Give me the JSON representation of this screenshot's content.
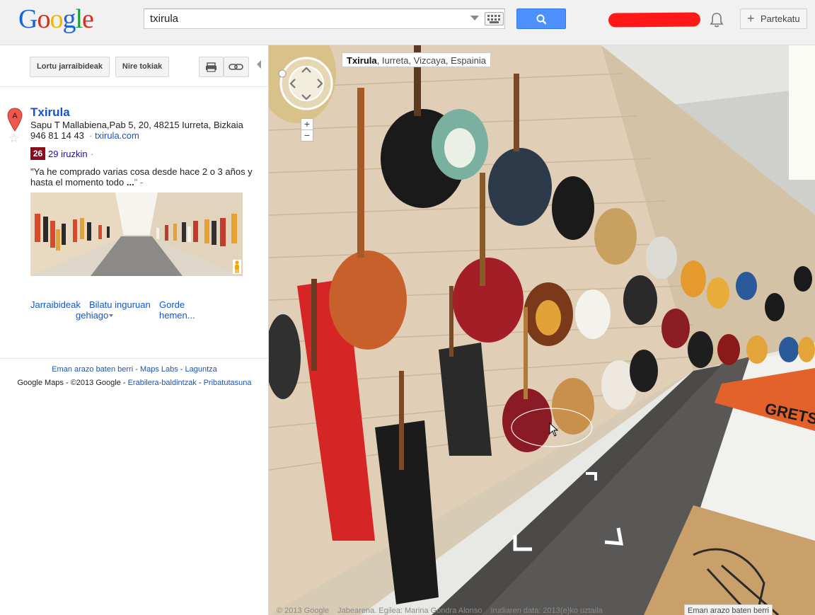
{
  "header": {
    "logo_text": "Google",
    "search_value": "txirula",
    "share_label": "Partekatu",
    "share_plus": "+"
  },
  "sidebar": {
    "directions_button": "Lortu jarraibideak",
    "my_places_button": "Nire tokiak",
    "marker_letter": "A",
    "place": {
      "title": "Txirula",
      "address": "Sapu T Mallabiena,Pab 5, 20, 48215 Iurreta, Bizkaia",
      "phone": "946 81 14 43",
      "dot": "·",
      "website": "txirula.com",
      "score": "26",
      "reviews": "29 iruzkin",
      "reviews_dot": "·",
      "quote_text": "\"Ya he comprado varias cosa desde hace 2 o 3 años y hasta el momento todo ",
      "quote_more": "...",
      "quote_end": "\" -"
    },
    "actions": {
      "directions": "Jarraibideak",
      "search_nearby": "Bilatu inguruan",
      "save_here": "Gorde hemen...",
      "more": "gehiago"
    },
    "footer": {
      "report": "Eman arazo baten berri",
      "sep1": " - ",
      "labs": "Maps Labs",
      "sep2": " - ",
      "help": "Laguntza",
      "copyright": "Google Maps - ©2013 Google - ",
      "terms": "Erabilera-baldintzak",
      "sep3": " - ",
      "privacy": "Pribatutasuna"
    }
  },
  "street_view": {
    "location_name": "Txirula",
    "location_rest": ", Iurreta, Vizcaya, Espainia",
    "copyright": "© 2013 Google",
    "owner": "Jabearena. Egilea: Marina Gondra Alonso",
    "date": "Irudiaren data: 2013(e)ko uztaila",
    "report": "Eman arazo baten berri",
    "zoom_in": "+",
    "zoom_out": "−",
    "floor_logo": "GRETSCH"
  },
  "colors": {
    "accent_blue": "#4d90fe",
    "link_blue": "#1155cc",
    "score_badge": "#8b0c1d",
    "redaction": "#ff1818"
  },
  "icons": [
    "search-icon",
    "keyboard-icon",
    "dropdown-arrow-icon",
    "bell-icon",
    "print-icon",
    "link-icon",
    "map-marker-icon",
    "star-icon",
    "pegman-icon",
    "compass-icon",
    "cursor-icon"
  ]
}
